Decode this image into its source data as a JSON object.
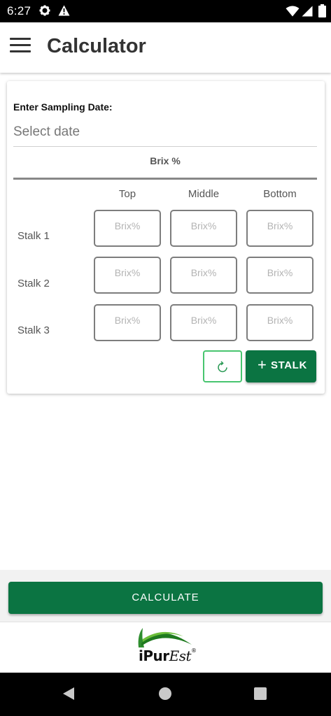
{
  "status_bar": {
    "time": "6:27",
    "icons": [
      "gear-icon",
      "warning-icon",
      "wifi-icon",
      "signal-icon",
      "battery-icon"
    ]
  },
  "app_bar": {
    "title": "Calculator",
    "menu_icon": "menu-icon"
  },
  "form": {
    "date_label": "Enter Sampling Date:",
    "date_placeholder": "Select date",
    "brix_title": "Brix %",
    "columns": [
      "Top",
      "Middle",
      "Bottom"
    ],
    "rows": [
      {
        "label": "Stalk 1",
        "placeholders": [
          "Brix%",
          "Brix%",
          "Brix%"
        ]
      },
      {
        "label": "Stalk 2",
        "placeholders": [
          "Brix%",
          "Brix%",
          "Brix%"
        ]
      },
      {
        "label": "Stalk 3",
        "placeholders": [
          "Brix%",
          "Brix%",
          "Brix%"
        ]
      }
    ],
    "reset_icon": "refresh-icon",
    "add_stalk_label": "STALK",
    "add_stalk_icon": "plus-icon"
  },
  "calculate_label": "CALCULATE",
  "footer": {
    "logo_main": "iPur",
    "logo_italic": "Est",
    "logo_reg": "®"
  },
  "nav_bar": {
    "icons": [
      "back-icon",
      "home-icon",
      "recents-icon"
    ]
  },
  "colors": {
    "primary": "#0b7442",
    "accent_border": "#48c56f",
    "status_bar": "#000000",
    "field_border": "#7d7d7d"
  }
}
